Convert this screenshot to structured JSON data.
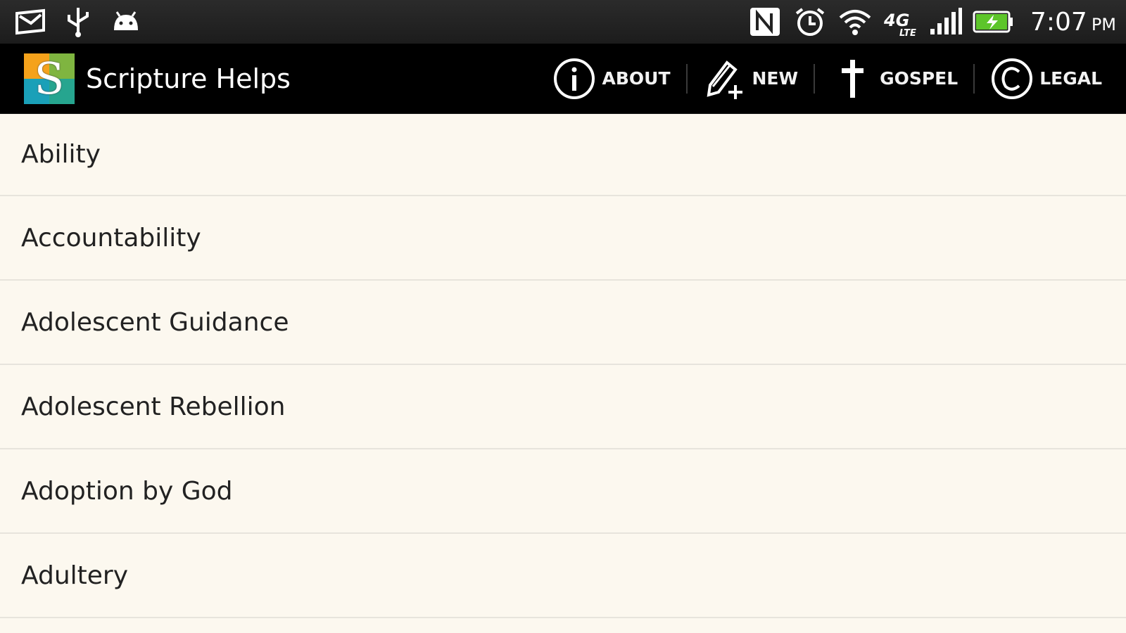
{
  "status_bar": {
    "left_icons": [
      "mail-icon",
      "usb-icon",
      "android-debug-icon"
    ],
    "right_icons": [
      "nfc-icon",
      "alarm-icon",
      "wifi-icon",
      "4g-lte-icon",
      "signal-icon",
      "battery-charging-icon"
    ],
    "time": "7:07",
    "ampm": "PM"
  },
  "action_bar": {
    "title": "Scripture Helps",
    "logo_letter": "S",
    "logo_colors": [
      "#f5a21b",
      "#7fb540",
      "#1aa0b8",
      "#26a58f"
    ],
    "actions": [
      {
        "label": "ABOUT",
        "icon": "info-icon"
      },
      {
        "label": "NEW",
        "icon": "pencil-plus-icon"
      },
      {
        "label": "GOSPEL",
        "icon": "cross-icon"
      },
      {
        "label": "LEGAL",
        "icon": "copyright-icon"
      }
    ]
  },
  "topics": [
    "Ability",
    "Accountability",
    "Adolescent Guidance",
    "Adolescent Rebellion",
    "Adoption by God",
    "Adultery"
  ]
}
